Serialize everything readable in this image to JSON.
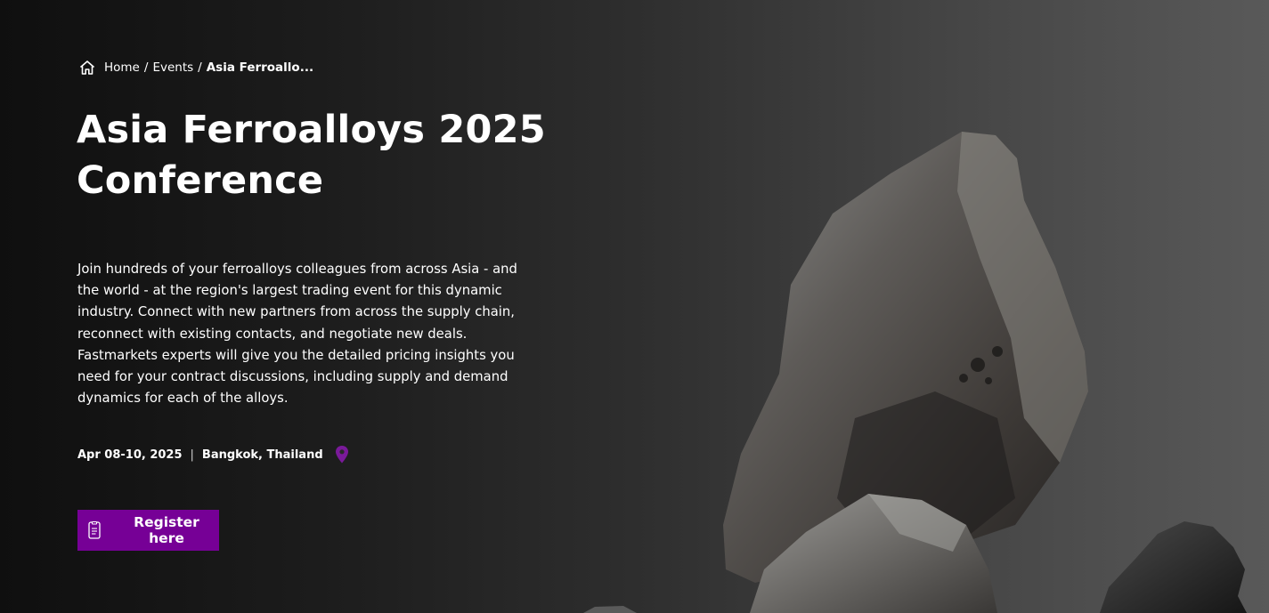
{
  "breadcrumb": {
    "items": [
      {
        "label": "Home"
      },
      {
        "label": "Events"
      }
    ],
    "separator": "/",
    "current": "Asia Ferroallo..."
  },
  "hero": {
    "title_line1": "Asia Ferroalloys 2025",
    "title_line2": "Conference",
    "description": "Join hundreds of your ferroalloys colleagues from across Asia - and the world - at the region's largest trading event for this dynamic industry. Connect with new partners from across the supply chain, reconnect with existing contacts, and negotiate new deals. Fastmarkets experts will give you the detailed pricing insights you need for your contract discussions, including supply and demand dynamics for each of the alloys.",
    "date": "Apr 08-10, 2025",
    "divider": "|",
    "location": "Bangkok, Thailand",
    "register_label": "Register here"
  },
  "icons": {
    "home": "home-icon",
    "location": "map-pin-icon",
    "register": "document-icon"
  },
  "colors": {
    "accent": "#760096",
    "pin": "#7a1a9a",
    "background_left": "#0f0f0f",
    "background_right": "#595959"
  }
}
